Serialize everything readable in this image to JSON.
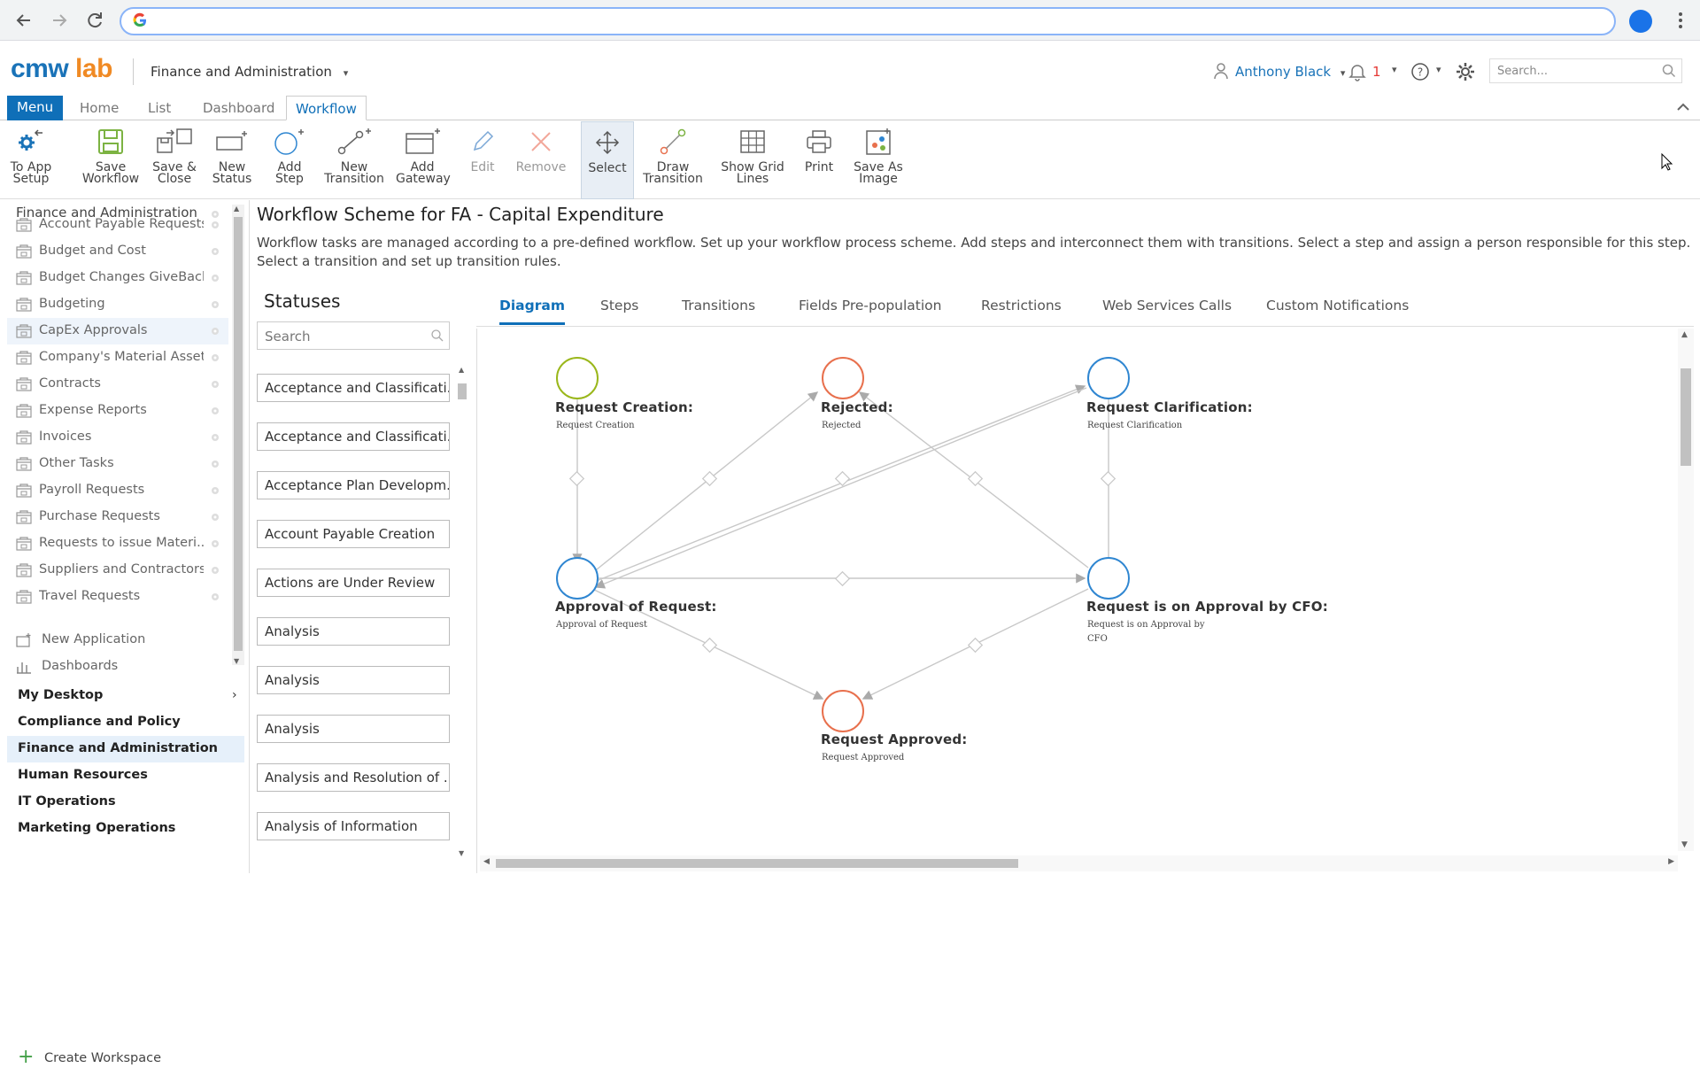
{
  "browser": {
    "address_value": ""
  },
  "header": {
    "logo_part1": "cmw",
    "logo_part2": "lab",
    "app_switcher": "Finance and Administration",
    "user_name": "Anthony Black",
    "notification_count": "1",
    "search_placeholder": "Search..."
  },
  "tabs": {
    "menu": "Menu",
    "home": "Home",
    "list": "List",
    "dashboard": "Dashboard",
    "workflow": "Workflow"
  },
  "toolbar": {
    "to_app_setup": [
      "To App",
      "Setup"
    ],
    "save_workflow": [
      "Save",
      "Workflow"
    ],
    "save_close": [
      "Save &",
      "Close"
    ],
    "new_status": [
      "New",
      "Status"
    ],
    "add_step": [
      "Add",
      "Step"
    ],
    "new_transition": [
      "New",
      "Transition"
    ],
    "add_gateway": [
      "Add",
      "Gateway"
    ],
    "edit": [
      "Edit"
    ],
    "remove": [
      "Remove"
    ],
    "select": [
      "Select"
    ],
    "draw_transition": [
      "Draw",
      "Transition"
    ],
    "show_grid_lines": [
      "Show Grid",
      "Lines"
    ],
    "print": [
      "Print"
    ],
    "save_as_image": [
      "Save As",
      "Image"
    ]
  },
  "sidebar": {
    "title": "Finance and Administration",
    "items": [
      "Account Payable Requests",
      "Budget and Cost",
      "Budget Changes GiveBack",
      "Budgeting",
      "CapEx Approvals",
      "Company's Material Assets",
      "Contracts",
      "Expense Reports",
      "Invoices",
      "Other Tasks",
      "Payroll Requests",
      "Purchase Requests",
      "Requests to issue Materi...",
      "Suppliers and Contractors",
      "Travel Requests"
    ],
    "selected_item": "CapEx Approvals",
    "new_application": "New Application",
    "dashboards": "Dashboards",
    "workspaces": [
      "My Desktop",
      "Compliance and Policy",
      "Finance and Administration",
      "Human Resources",
      "IT Operations",
      "Marketing Operations"
    ],
    "selected_workspace": "Finance and Administration",
    "create_workspace": "Create Workspace"
  },
  "page": {
    "title": "Workflow Scheme for FA - Capital Expenditure",
    "description": "Workflow tasks are managed according to a pre-defined workflow. Set up your workflow process scheme. Add steps and interconnect them with transitions. Select a step and assign a person responsible for this step. Select a transition and set up transition rules."
  },
  "statuses": {
    "title": "Statuses",
    "search_placeholder": "Search",
    "items": [
      "Acceptance and Classificati...",
      "Acceptance and Classificati...",
      "Acceptance Plan Developm...",
      "Account Payable Creation",
      "Actions are Under Review",
      "Analysis",
      "Analysis",
      "Analysis",
      "Analysis and Resolution of ...",
      "Analysis of Information"
    ]
  },
  "main_tabs": [
    "Diagram",
    "Steps",
    "Transitions",
    "Fields Pre-population",
    "Restrictions",
    "Web Services Calls",
    "Custom Notifications"
  ],
  "active_main_tab": "Diagram",
  "diagram": {
    "nodes": [
      {
        "id": "creation",
        "label": "Request Creation:",
        "status": "Request Creation",
        "color": "#9ab71b"
      },
      {
        "id": "rejected",
        "label": "Rejected:",
        "status": "Rejected",
        "color": "#e8704d"
      },
      {
        "id": "clarification",
        "label": "Request Clarification:",
        "status": "Request Clarification",
        "color": "#2f86d1"
      },
      {
        "id": "approval",
        "label": "Approval of Request:",
        "status": "Approval of Request",
        "color": "#2f86d1"
      },
      {
        "id": "cfo",
        "label": "Request is on Approval by CFO:",
        "status_lines": [
          "Request is on Approval by",
          "CFO"
        ],
        "color": "#2f86d1"
      },
      {
        "id": "approved",
        "label": "Request Approved:",
        "status": "Request Approved",
        "color": "#e8704d"
      }
    ]
  },
  "colors": {
    "brand_blue": "#1a73b8",
    "brand_orange": "#f08a24",
    "accent": "#0f6fb8"
  }
}
